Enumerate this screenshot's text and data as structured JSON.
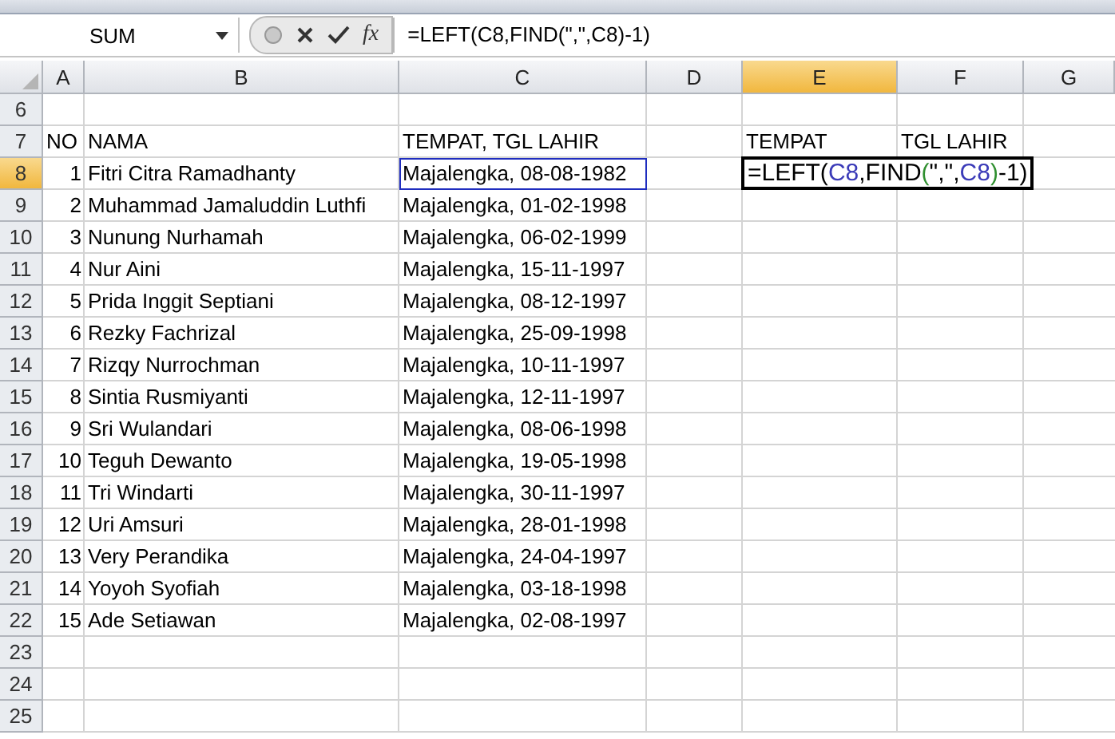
{
  "name_box": "SUM",
  "formula_bar": {
    "function_label": "fx",
    "formula": "=LEFT(C8,FIND(\",\",C8)-1)"
  },
  "columns": [
    {
      "label": "A",
      "selected": false
    },
    {
      "label": "B",
      "selected": false
    },
    {
      "label": "C",
      "selected": false
    },
    {
      "label": "D",
      "selected": false
    },
    {
      "label": "E",
      "selected": true
    },
    {
      "label": "F",
      "selected": false
    },
    {
      "label": "G",
      "selected": false
    }
  ],
  "rows": [
    {
      "number": "6",
      "selected": false
    },
    {
      "number": "7",
      "selected": false,
      "kind": "heading",
      "cells": [
        {
          "text": "NO"
        },
        {
          "text": "NAMA"
        },
        {
          "text": "TEMPAT, TGL LAHIR"
        },
        {},
        {
          "text": "TEMPAT"
        },
        {
          "text": "TGL LAHIR"
        }
      ]
    },
    {
      "number": "8",
      "selected": true,
      "kind": "data",
      "cells": [
        {
          "text": "1"
        },
        {
          "text": "Fitri Citra Ramadhanty"
        },
        {
          "text": "Majalengka, 08-08-1982",
          "referenced": true
        },
        {},
        {
          "editor": [
            {
              "kind": "text",
              "text": "=LEFT("
            },
            {
              "kind": "ref",
              "text": "C8"
            },
            {
              "kind": "text",
              "text": ",FIND"
            },
            {
              "kind": "paren",
              "text": "("
            },
            {
              "kind": "text",
              "text": "\",\","
            },
            {
              "kind": "ref",
              "text": "C8"
            },
            {
              "kind": "paren",
              "text": ")"
            },
            {
              "kind": "text",
              "text": "-1)"
            }
          ]
        }
      ]
    },
    {
      "number": "9",
      "selected": false,
      "kind": "data",
      "cells": [
        {
          "text": "2"
        },
        {
          "text": "Muhammad Jamaluddin Luthfi"
        },
        {
          "text": "Majalengka, 01-02-1998",
          "referenced": false
        }
      ]
    },
    {
      "number": "10",
      "selected": false,
      "kind": "data",
      "cells": [
        {
          "text": "3"
        },
        {
          "text": "Nunung Nurhamah"
        },
        {
          "text": "Majalengka, 06-02-1999",
          "referenced": false
        }
      ]
    },
    {
      "number": "11",
      "selected": false,
      "kind": "data",
      "cells": [
        {
          "text": "4"
        },
        {
          "text": "Nur Aini"
        },
        {
          "text": "Majalengka, 15-11-1997",
          "referenced": false
        }
      ]
    },
    {
      "number": "12",
      "selected": false,
      "kind": "data",
      "cells": [
        {
          "text": "5"
        },
        {
          "text": "Prida Inggit Septiani"
        },
        {
          "text": "Majalengka, 08-12-1997",
          "referenced": false
        }
      ]
    },
    {
      "number": "13",
      "selected": false,
      "kind": "data",
      "cells": [
        {
          "text": "6"
        },
        {
          "text": "Rezky Fachrizal"
        },
        {
          "text": "Majalengka, 25-09-1998",
          "referenced": false
        }
      ]
    },
    {
      "number": "14",
      "selected": false,
      "kind": "data",
      "cells": [
        {
          "text": "7"
        },
        {
          "text": "Rizqy Nurrochman"
        },
        {
          "text": "Majalengka, 10-11-1997",
          "referenced": false
        }
      ]
    },
    {
      "number": "15",
      "selected": false,
      "kind": "data",
      "cells": [
        {
          "text": "8"
        },
        {
          "text": "Sintia Rusmiyanti"
        },
        {
          "text": "Majalengka, 12-11-1997",
          "referenced": false
        }
      ]
    },
    {
      "number": "16",
      "selected": false,
      "kind": "data",
      "cells": [
        {
          "text": "9"
        },
        {
          "text": "Sri Wulandari"
        },
        {
          "text": "Majalengka, 08-06-1998",
          "referenced": false
        }
      ]
    },
    {
      "number": "17",
      "selected": false,
      "kind": "data",
      "cells": [
        {
          "text": "10"
        },
        {
          "text": "Teguh Dewanto"
        },
        {
          "text": "Majalengka, 19-05-1998",
          "referenced": false
        }
      ]
    },
    {
      "number": "18",
      "selected": false,
      "kind": "data",
      "cells": [
        {
          "text": "11"
        },
        {
          "text": "Tri Windarti"
        },
        {
          "text": "Majalengka, 30-11-1997",
          "referenced": false
        }
      ]
    },
    {
      "number": "19",
      "selected": false,
      "kind": "data",
      "cells": [
        {
          "text": "12"
        },
        {
          "text": "Uri Amsuri"
        },
        {
          "text": "Majalengka, 28-01-1998",
          "referenced": false
        }
      ]
    },
    {
      "number": "20",
      "selected": false,
      "kind": "data",
      "cells": [
        {
          "text": "13"
        },
        {
          "text": "Very Perandika"
        },
        {
          "text": "Majalengka, 24-04-1997",
          "referenced": false
        }
      ]
    },
    {
      "number": "21",
      "selected": false,
      "kind": "data",
      "cells": [
        {
          "text": "14"
        },
        {
          "text": "Yoyoh Syofiah"
        },
        {
          "text": "Majalengka, 03-18-1998",
          "referenced": false
        }
      ]
    },
    {
      "number": "22",
      "selected": false,
      "kind": "data",
      "cells": [
        {
          "text": "15"
        },
        {
          "text": "Ade Setiawan"
        },
        {
          "text": "Majalengka, 02-08-1997",
          "referenced": false
        }
      ]
    },
    {
      "number": "23",
      "selected": false
    },
    {
      "number": "24",
      "selected": false
    },
    {
      "number": "25",
      "selected": false
    }
  ]
}
